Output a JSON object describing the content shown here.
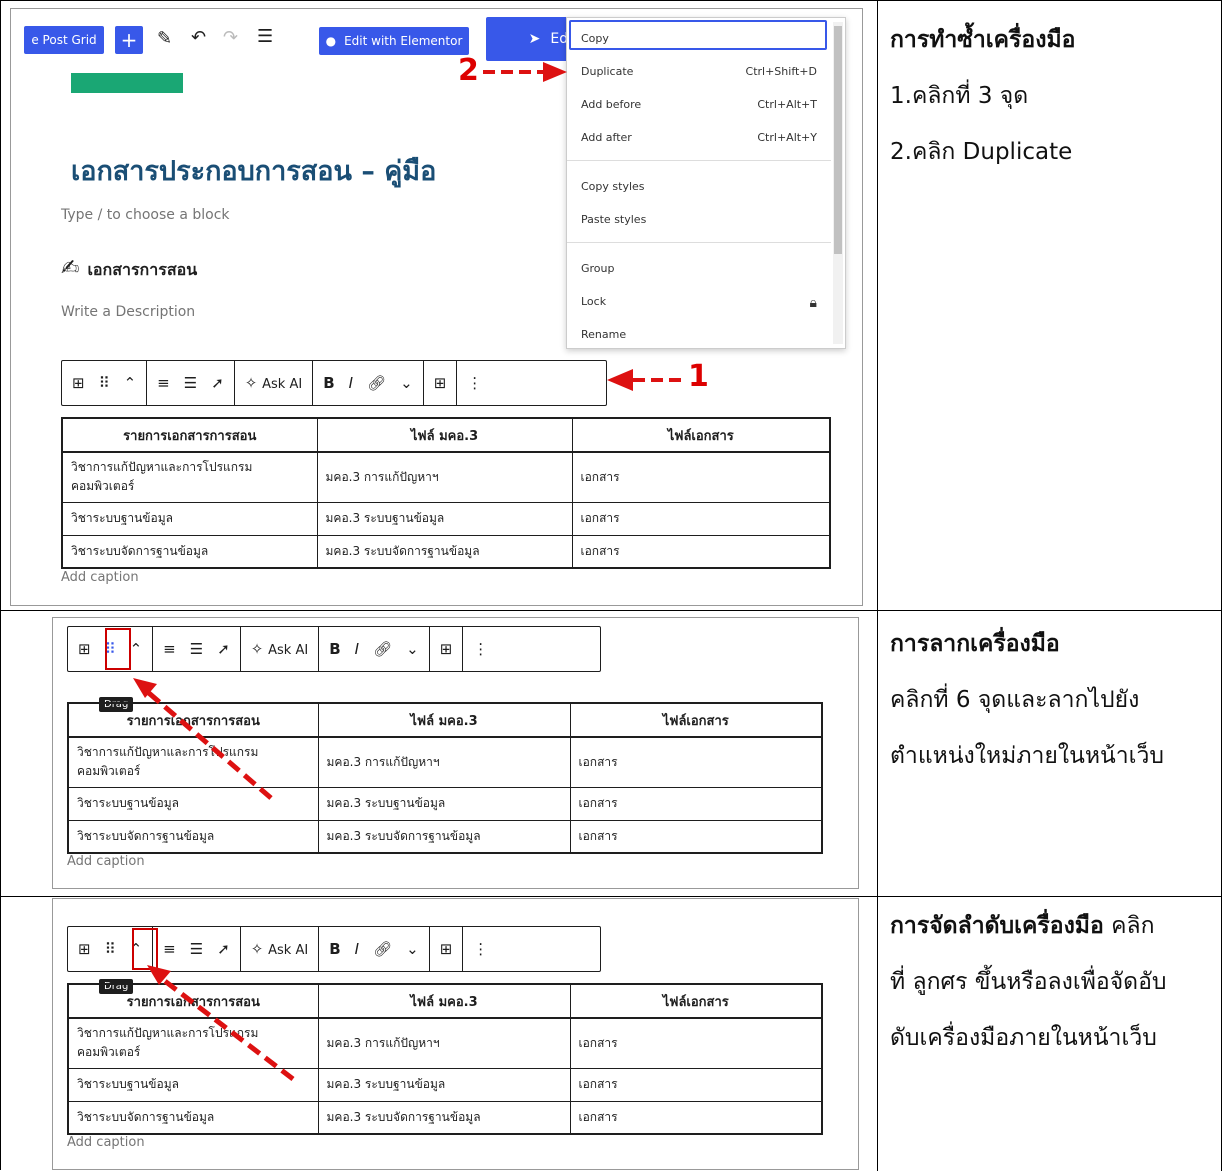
{
  "panels": [
    {
      "title": "การทำซ้ำเครื่องมือ",
      "steps": [
        "1.คลิกที่ 3 จุด",
        "2.คลิก Duplicate"
      ]
    },
    {
      "title": "การลากเครื่องมือ",
      "lines": [
        "คลิกที่ 6 จุดและลากไปยัง",
        "ตำแหน่งใหม่ภายในหน้าเว็บ"
      ]
    },
    {
      "title": "การจัดลำดับเครื่องมือ",
      "title_tail": "คลิก",
      "lines": [
        "ที่ ลูกศร ขึ้นหรือลงเพื่อจัดอับ",
        "ดับเครื่องมือภายในหน้าเว็บ"
      ]
    }
  ],
  "editor": {
    "post_grid_label": "e Post Grid",
    "elementor_label": "Edit with Elementor",
    "edit_partial": "Edi",
    "page_title": "เอกสารประกอบการสอน – คู่มือ",
    "block_placeholder": "Type / to choose a block",
    "section_heading": "เอกสารการสอน",
    "description_placeholder": "Write a Description"
  },
  "menu": {
    "items": [
      {
        "label": "Copy",
        "shortcut": ""
      },
      {
        "label": "Duplicate",
        "shortcut": "Ctrl+Shift+D"
      },
      {
        "label": "Add before",
        "shortcut": "Ctrl+Alt+T"
      },
      {
        "label": "Add after",
        "shortcut": "Ctrl+Alt+Y"
      },
      {
        "label": "Copy styles",
        "shortcut": ""
      },
      {
        "label": "Paste styles",
        "shortcut": ""
      },
      {
        "label": "Group",
        "shortcut": ""
      },
      {
        "label": "Lock",
        "shortcut": ""
      },
      {
        "label": "Rename",
        "shortcut": ""
      }
    ]
  },
  "toolbar": {
    "ask_ai": "Ask AI",
    "bold": "B",
    "italic": "I",
    "drag_tooltip": "Drag"
  },
  "annotations": {
    "step1": "1",
    "step2": "2"
  },
  "table": {
    "headers": [
      "รายการเอกสารการสอน",
      "ไฟล์ มคอ.3",
      "ไฟล์เอกสาร"
    ],
    "rows": [
      [
        "วิชาการแก้ปัญหาและการโปรแกรม คอมพิวเตอร์",
        "มคอ.3 การแก้ปัญหาฯ",
        "เอกสาร"
      ],
      [
        "วิชาระบบฐานข้อมูล",
        "มคอ.3 ระบบฐานข้อมูล",
        "เอกสาร"
      ],
      [
        "วิชาระบบจัดการฐานข้อมูล",
        "มคอ.3 ระบบจัดการฐานข้อมูล",
        "เอกสาร"
      ]
    ],
    "caption": "Add caption"
  },
  "colors": {
    "accent": "#3858e9",
    "title": "#1a4e75",
    "arrow": "#dd1111"
  }
}
